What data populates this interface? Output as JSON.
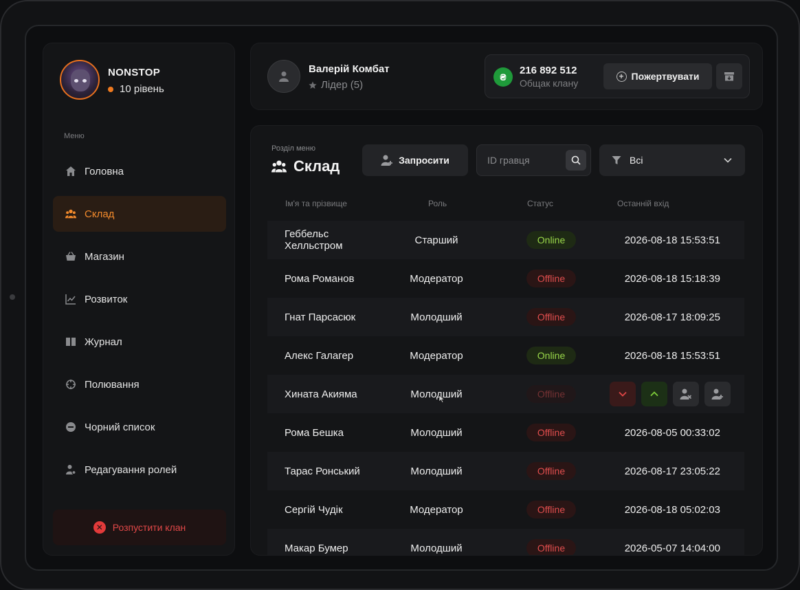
{
  "sidebar": {
    "clan_name": "NONSTOP",
    "clan_level": "10 рівень",
    "menu_caption": "Меню",
    "items": [
      {
        "label": "Головна",
        "icon": "home-icon"
      },
      {
        "label": "Склад",
        "icon": "users-icon",
        "active": true
      },
      {
        "label": "Магазин",
        "icon": "basket-icon"
      },
      {
        "label": "Розвиток",
        "icon": "chart-icon"
      },
      {
        "label": "Журнал",
        "icon": "book-icon"
      },
      {
        "label": "Полювання",
        "icon": "crosshair-icon"
      },
      {
        "label": "Чорний список",
        "icon": "minus-circle-icon"
      },
      {
        "label": "Редагування ролей",
        "icon": "user-gear-icon"
      }
    ],
    "disband_label": "Розпустити клан"
  },
  "header": {
    "leader_name": "Валерій Комбат",
    "leader_role": "Лідер (5)",
    "bank_amount": "216 892 512",
    "bank_caption": "Общак клану",
    "bank_currency_icon": "₴",
    "donate_label": "Пожертвувати"
  },
  "main": {
    "section_caption": "Розділ меню",
    "section_title": "Склад",
    "invite_label": "Запросити",
    "search_placeholder": "ID гравця",
    "filter_value": "Всі",
    "columns": [
      "Ім'я та прізвище",
      "Роль",
      "Статус",
      "Останній вхід"
    ],
    "members": [
      {
        "name": "Геббельс Хелльстром",
        "role": "Старший",
        "status": "Online",
        "last_login": "2026-08-18 15:53:51"
      },
      {
        "name": "Рома Романов",
        "role": "Модератор",
        "status": "Offline",
        "last_login": "2026-08-18 15:18:39"
      },
      {
        "name": "Гнат Парсасюк",
        "role": "Молодший",
        "status": "Offline",
        "last_login": "2026-08-17 18:09:25"
      },
      {
        "name": "Алекс Галагер",
        "role": "Модератор",
        "status": "Online",
        "last_login": "2026-08-18 15:53:51"
      },
      {
        "name": "Хината Акияма",
        "role": "Молодший",
        "status": "Offline",
        "last_login": ""
      },
      {
        "name": "Рома Бешка",
        "role": "Молодший",
        "status": "Offline",
        "last_login": "2026-08-05 00:33:02"
      },
      {
        "name": "Тарас Ронський",
        "role": "Молодший",
        "status": "Offline",
        "last_login": "2026-08-17 23:05:22"
      },
      {
        "name": "Сергій Чудік",
        "role": "Модератор",
        "status": "Offline",
        "last_login": "2026-08-18 05:02:03"
      },
      {
        "name": "Макар Бумер",
        "role": "Молодший",
        "status": "Offline",
        "last_login": "2026-05-07 14:04:00"
      }
    ]
  },
  "colors": {
    "accent": "#f28a2c",
    "online": "#9ad84a",
    "offline": "#e24e4e",
    "bank": "#1f9a3a"
  }
}
